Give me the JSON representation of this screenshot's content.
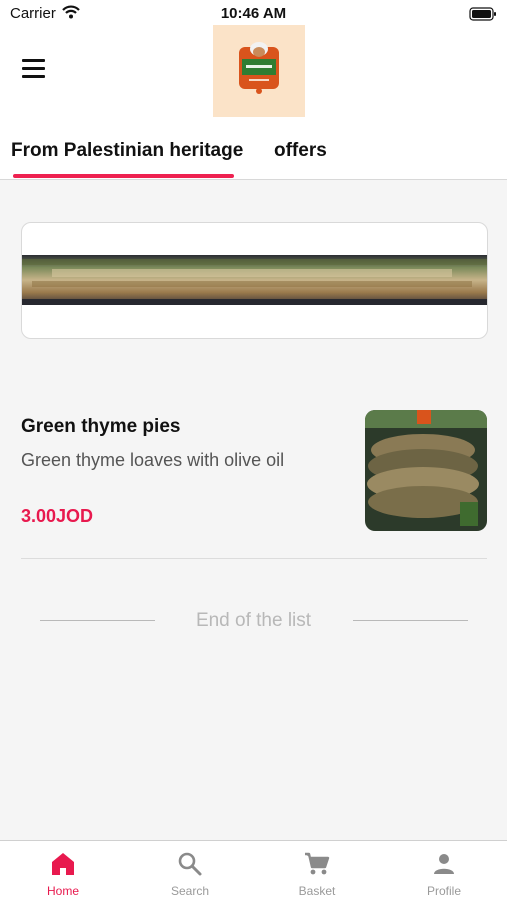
{
  "status_bar": {
    "carrier": "Carrier",
    "time": "10:46 AM"
  },
  "header": {
    "logo_alt": "restaurant-logo"
  },
  "tabs": [
    {
      "label": "From Palestinian heritage",
      "active": true
    },
    {
      "label": "offers",
      "active": false
    }
  ],
  "products": [
    {
      "name": "Green thyme pies",
      "description": "Green thyme loaves with olive oil",
      "price": "3.00JOD"
    }
  ],
  "end_of_list": "End of the list",
  "bottom_nav": [
    {
      "label": "Home",
      "icon": "home-icon",
      "active": true
    },
    {
      "label": "Search",
      "icon": "search-icon",
      "active": false
    },
    {
      "label": "Basket",
      "icon": "cart-icon",
      "active": false
    },
    {
      "label": "Profile",
      "icon": "person-icon",
      "active": false
    }
  ],
  "colors": {
    "accent": "#e8194e",
    "tab_indicator": "#ee2150",
    "background": "#f5f5f5"
  }
}
